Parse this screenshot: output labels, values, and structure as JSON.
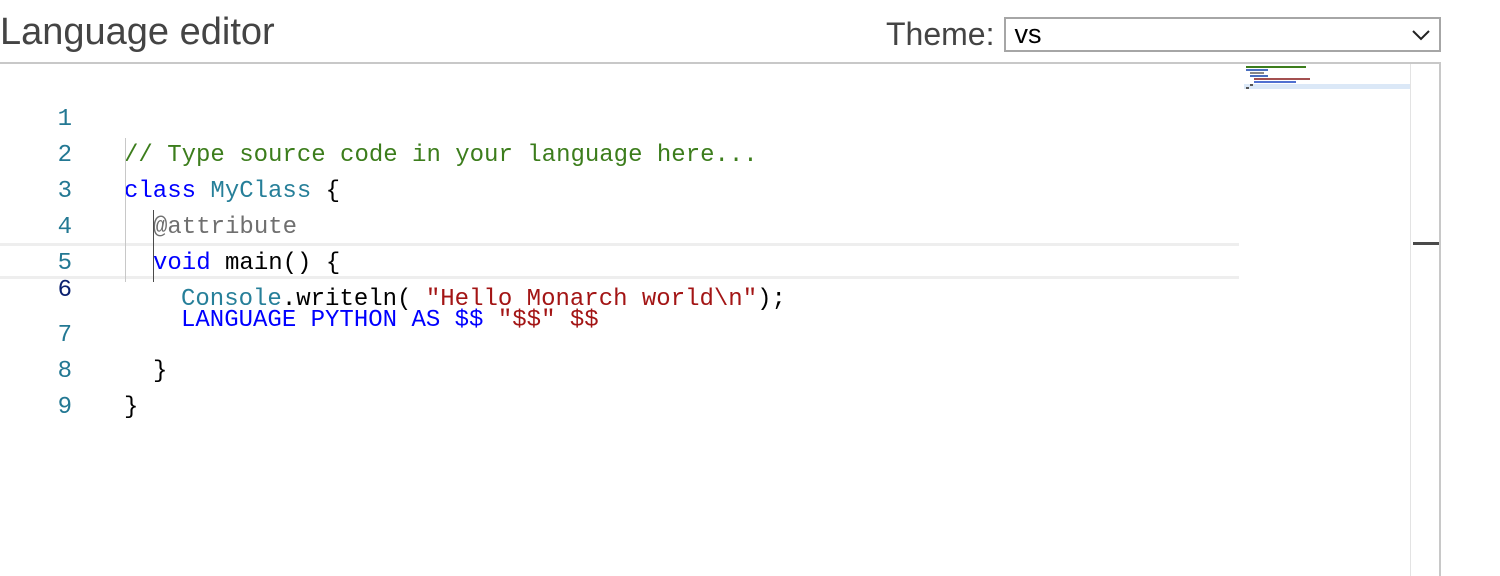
{
  "header": {
    "title": "Language editor"
  },
  "theme": {
    "label": "Theme:",
    "value": "vs"
  },
  "editor": {
    "current_line": 6,
    "lines": [
      {
        "num": "1",
        "tokens": [
          "// Type source code in your language here..."
        ]
      },
      {
        "num": "2",
        "tokens": [
          "class",
          " ",
          "MyClass",
          " {"
        ]
      },
      {
        "num": "3",
        "tokens": [
          "@attribute"
        ]
      },
      {
        "num": "4",
        "tokens": [
          "void",
          " main() {"
        ]
      },
      {
        "num": "5",
        "tokens": [
          "Console",
          ".writeln( ",
          "\"Hello Monarch world\\n\"",
          ");"
        ]
      },
      {
        "num": "6",
        "tokens": [
          "LANGUAGE PYTHON AS $$",
          " ",
          "\"$$\"",
          " ",
          "$$"
        ]
      },
      {
        "num": "7",
        "tokens": [
          "}"
        ]
      },
      {
        "num": "8",
        "tokens": [
          "}"
        ]
      },
      {
        "num": "9",
        "tokens": []
      }
    ]
  },
  "colors": {
    "comment": "#3c7d1c",
    "keyword": "#0000ff",
    "type": "#267f99",
    "string": "#a31515",
    "annotation": "#6f6f6f",
    "line_number": "#237893"
  }
}
